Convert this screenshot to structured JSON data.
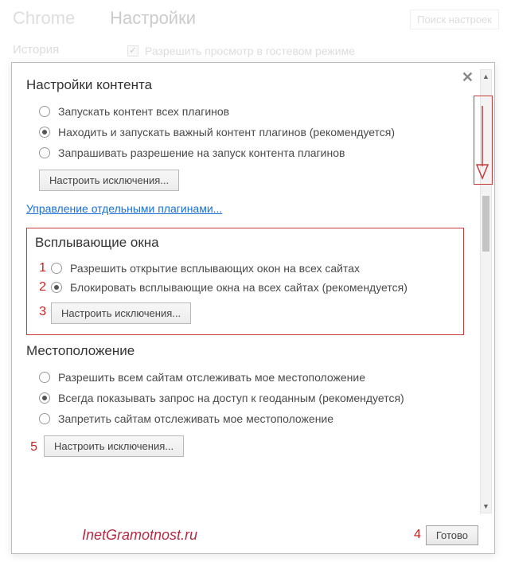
{
  "background": {
    "app_name": "Chrome",
    "page_title": "Настройки",
    "search_placeholder": "Поиск настроек",
    "sidebar_history": "История",
    "guest_checkbox_label": "Разрешить просмотр в гостевом режиме"
  },
  "modal": {
    "title": "Настройки контента",
    "plugins": {
      "opt_run_all": "Запускать контент всех плагинов",
      "opt_detect": "Находить и запускать важный контент плагинов (рекомендуется)",
      "opt_ask": "Запрашивать разрешение на запуск контента плагинов",
      "exceptions_btn": "Настроить исключения...",
      "manage_link": "Управление отдельными плагинами..."
    },
    "popups": {
      "heading": "Всплывающие окна",
      "opt_allow": "Разрешить открытие всплывающих окон на всех сайтах",
      "opt_block": "Блокировать всплывающие окна на всех сайтах (рекомендуется)",
      "exceptions_btn": "Настроить исключения..."
    },
    "location": {
      "heading": "Местоположение",
      "opt_allow": "Разрешить всем сайтам отслеживать мое местоположение",
      "opt_ask": "Всегда показывать запрос на доступ к геоданным (рекомендуется)",
      "opt_block": "Запретить сайтам отслеживать мое местоположение",
      "exceptions_btn": "Настроить исключения..."
    },
    "done_btn": "Готово"
  },
  "annotations": {
    "n1": "1",
    "n2": "2",
    "n3": "3",
    "n4": "4",
    "n5": "5",
    "watermark": "InetGramotnost.ru"
  }
}
